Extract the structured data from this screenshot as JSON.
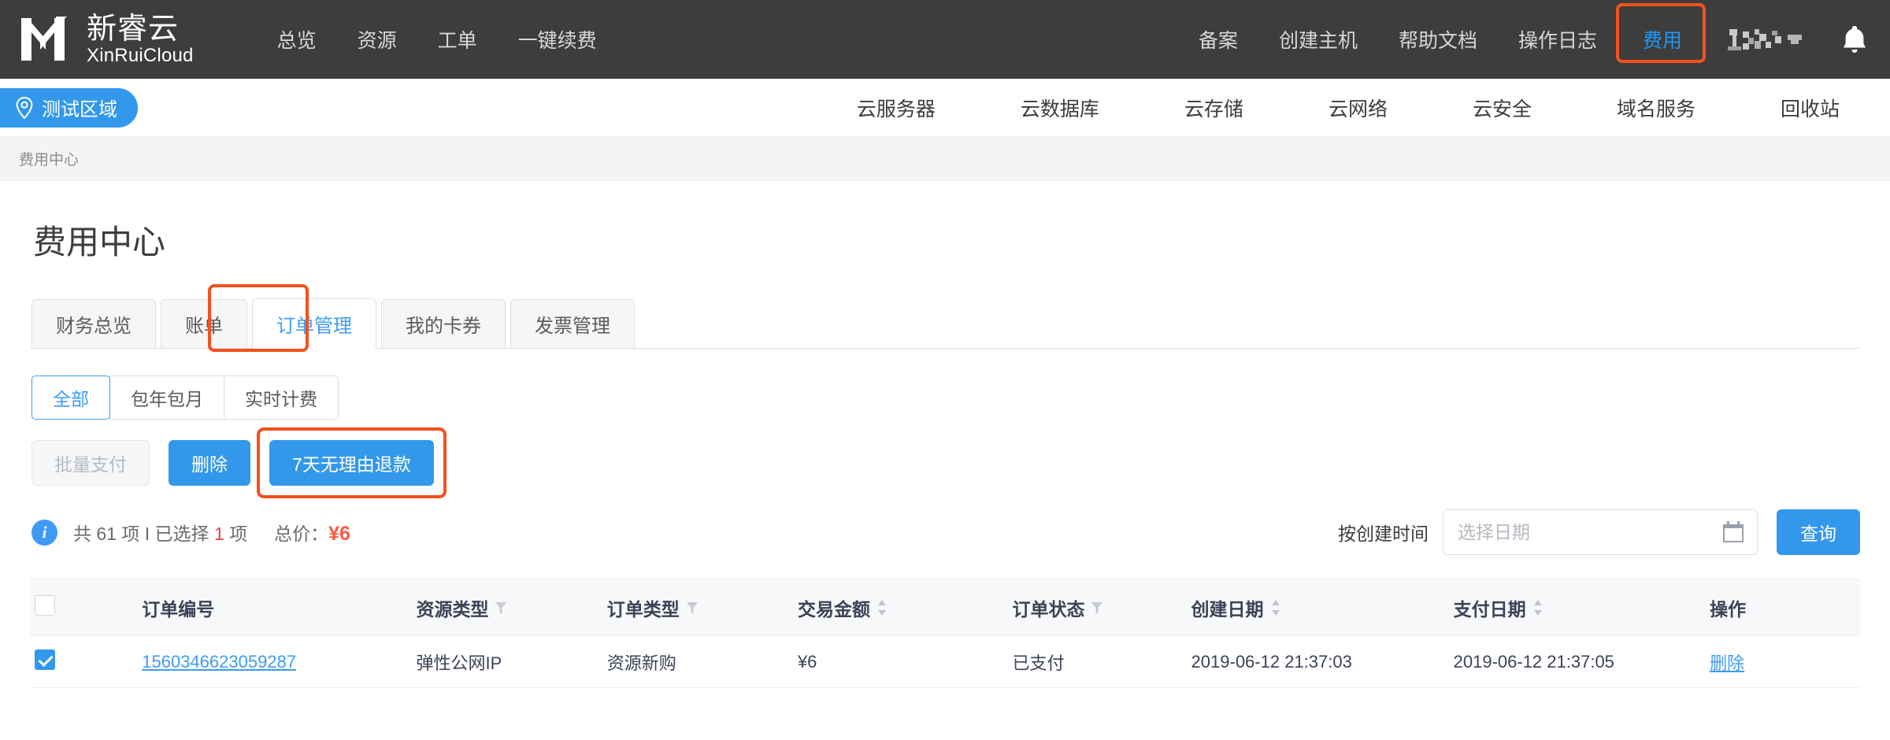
{
  "brand": {
    "name_cn": "新睿云",
    "name_en": "XinRuiCloud"
  },
  "header": {
    "nav": [
      {
        "label": "总览"
      },
      {
        "label": "资源"
      },
      {
        "label": "工单"
      },
      {
        "label": "一键续费"
      }
    ],
    "right_nav": [
      {
        "label": "备案",
        "active": false
      },
      {
        "label": "创建主机",
        "active": false
      },
      {
        "label": "帮助文档",
        "active": false
      },
      {
        "label": "操作日志",
        "active": false
      },
      {
        "label": "费用",
        "active": true
      }
    ],
    "user_menu": "",
    "bell_icon": "bell-icon"
  },
  "subnav": {
    "region": "测试区域",
    "region_icon": "location-pin-icon",
    "links": [
      {
        "label": "云服务器"
      },
      {
        "label": "云数据库"
      },
      {
        "label": "云存储"
      },
      {
        "label": "云网络"
      },
      {
        "label": "云安全"
      },
      {
        "label": "域名服务"
      },
      {
        "label": "回收站"
      }
    ]
  },
  "breadcrumb": "费用中心",
  "page": {
    "title": "费用中心",
    "tabs": [
      {
        "label": "财务总览",
        "active": false
      },
      {
        "label": "账单",
        "active": false
      },
      {
        "label": "订单管理",
        "active": true
      },
      {
        "label": "我的卡券",
        "active": false
      },
      {
        "label": "发票管理",
        "active": false
      }
    ],
    "segments": [
      {
        "label": "全部",
        "active": true
      },
      {
        "label": "包年包月",
        "active": false
      },
      {
        "label": "实时计费",
        "active": false
      }
    ],
    "actions": {
      "batch_pay": "批量支付",
      "delete": "删除",
      "refund": "7天无理由退款"
    },
    "info": {
      "prefix": "共 61 项 I 已选择 ",
      "selected": "1",
      "suffix": " 项",
      "total_label": "总价：",
      "total_value": "¥6"
    },
    "filter": {
      "label": "按创建时间",
      "date_value": "",
      "date_placeholder": "选择日期",
      "calendar_icon": "calendar-icon",
      "query_button": "查询"
    },
    "table": {
      "columns": [
        {
          "label": "",
          "kind": "checkbox"
        },
        {
          "label": "订单编号",
          "kind": "plain"
        },
        {
          "label": "资源类型",
          "kind": "filter"
        },
        {
          "label": "订单类型",
          "kind": "filter"
        },
        {
          "label": "交易金额",
          "kind": "sort"
        },
        {
          "label": "订单状态",
          "kind": "filter"
        },
        {
          "label": "创建日期",
          "kind": "sort"
        },
        {
          "label": "支付日期",
          "kind": "sort"
        },
        {
          "label": "操作",
          "kind": "plain"
        }
      ],
      "rows": [
        {
          "checked": true,
          "order_id": "1560346623059287",
          "resource_type": "弹性公网IP",
          "order_type": "资源新购",
          "amount": "¥6",
          "status": "已支付",
          "created_at": "2019-06-12 21:37:03",
          "paid_at": "2019-06-12 21:37:05",
          "action": "删除"
        }
      ]
    }
  },
  "colors": {
    "header_bg": "#3d3d3d",
    "accent_blue": "#3398eb",
    "link_blue": "#3d9bf5",
    "annotation_orange": "#f4511e",
    "price_red": "#fb5b41",
    "selected_red": "#e8453c"
  }
}
